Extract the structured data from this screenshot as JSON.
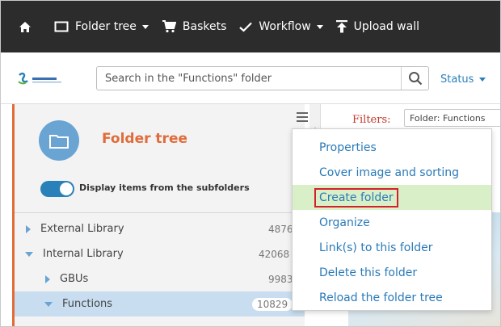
{
  "topnav": {
    "items": [
      {
        "label": "",
        "icon": "home-icon"
      },
      {
        "label": "Folder tree",
        "icon": "folder-outline-icon",
        "dropdown": true
      },
      {
        "label": "Baskets",
        "icon": "cart-icon"
      },
      {
        "label": "Workflow",
        "icon": "check-icon",
        "dropdown": true
      },
      {
        "label": "Upload wall",
        "icon": "upload-icon"
      }
    ]
  },
  "searchbar": {
    "logo_icon": "solvay-logo",
    "placeholder": "Search in the \"Functions\" folder",
    "status_label": "Status"
  },
  "sidebar": {
    "title": "Folder tree",
    "toggle_label": "Display items from the subfolders",
    "toggle_on": true,
    "tree": [
      {
        "label": "External Library",
        "count": "4876",
        "expanded": false,
        "level": 0
      },
      {
        "label": "Internal Library",
        "count": "42068",
        "expanded": true,
        "level": 0
      },
      {
        "label": "GBUs",
        "count": "9983",
        "expanded": false,
        "level": 1
      },
      {
        "label": "Functions",
        "count": "10829",
        "expanded": true,
        "level": 1,
        "selected": true
      }
    ]
  },
  "filters": {
    "label": "Filters:",
    "chip": "Folder: Functions"
  },
  "context_menu": {
    "items": [
      {
        "label": "Properties"
      },
      {
        "label": "Cover image and sorting"
      },
      {
        "label": "Create folder",
        "highlighted": true
      },
      {
        "label": "Organize"
      },
      {
        "label": "Link(s) to this folder"
      },
      {
        "label": "Delete this folder"
      },
      {
        "label": "Reload the folder tree"
      }
    ]
  },
  "colors": {
    "nav_bg": "#2c2c2c",
    "accent_orange": "#e06c3b",
    "link_blue": "#2a7ab8",
    "highlight_green": "#d9efc8",
    "callout_red": "#d3202a"
  }
}
